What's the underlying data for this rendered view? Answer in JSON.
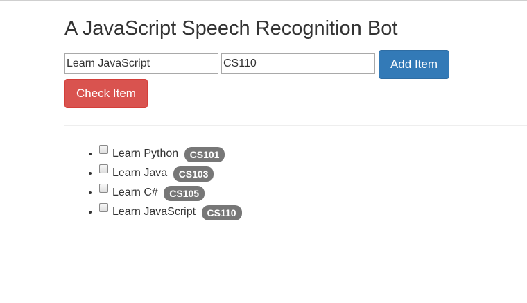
{
  "page": {
    "title": "A JavaScript Speech Recognition Bot"
  },
  "form": {
    "item_input_value": "Learn JavaScript",
    "code_input_value": "CS110",
    "add_button_label": "Add Item",
    "check_button_label": "Check Item"
  },
  "colors": {
    "add_button": "#337ab7",
    "check_button": "#d9534f",
    "badge": "#777777"
  },
  "list": {
    "items": [
      {
        "label": "Learn Python",
        "code": "CS101",
        "checked": false
      },
      {
        "label": "Learn Java",
        "code": "CS103",
        "checked": false
      },
      {
        "label": "Learn C#",
        "code": "CS105",
        "checked": false
      },
      {
        "label": "Learn JavaScript",
        "code": "CS110",
        "checked": false
      }
    ]
  }
}
